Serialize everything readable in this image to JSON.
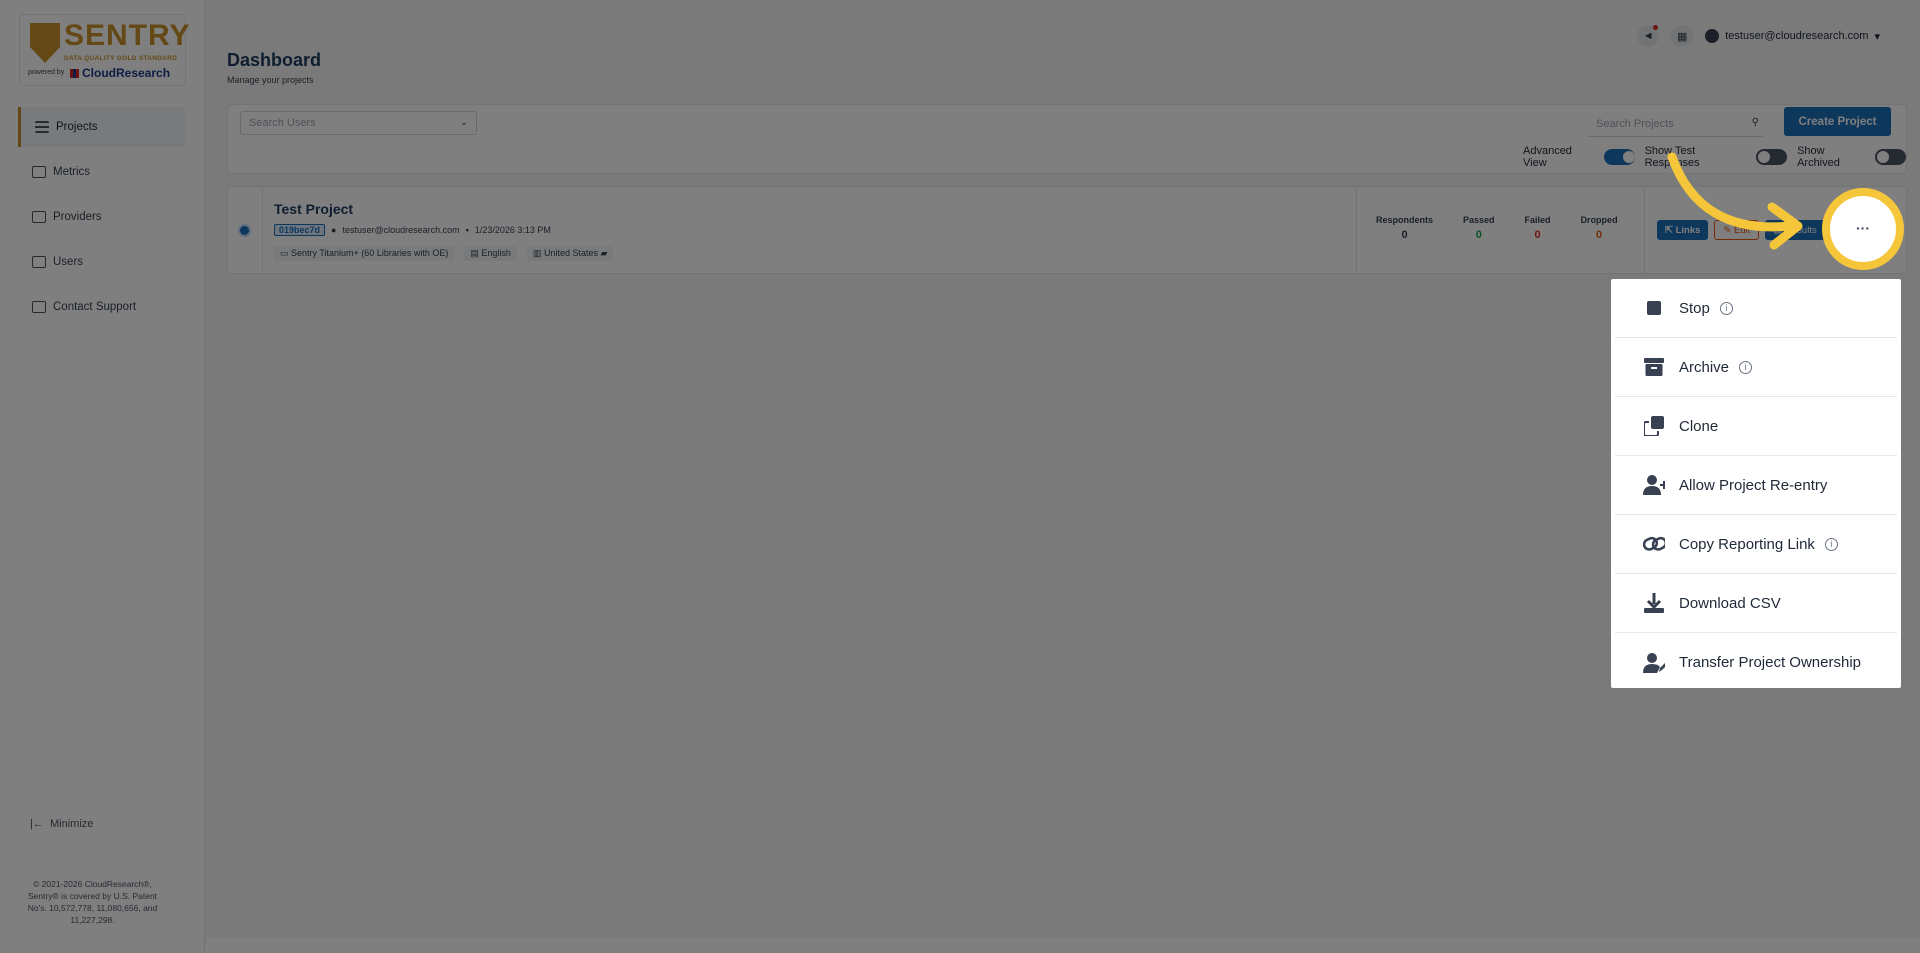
{
  "brand": {
    "name": "SENTRY",
    "tagline": "DATA QUALITY GOLD STANDARD",
    "powered_by": "powered by",
    "company": "CloudResearch"
  },
  "sidebar": {
    "items": [
      {
        "label": "Projects",
        "icon": "list-icon"
      },
      {
        "label": "Metrics",
        "icon": "chart-icon"
      },
      {
        "label": "Providers",
        "icon": "people-icon"
      },
      {
        "label": "Users",
        "icon": "user-icon"
      },
      {
        "label": "Contact Support",
        "icon": "mail-icon"
      }
    ],
    "minimize_label": "Minimize",
    "copyright": "© 2021-2026 CloudResearch®, Sentry® is covered by U.S. Patent No's. 10,572,778, 11,080,656, and 11,227,298."
  },
  "header": {
    "user_email": "testuser@cloudresearch.com"
  },
  "page": {
    "title": "Dashboard",
    "subtitle": "Manage your projects"
  },
  "filters": {
    "search_users_placeholder": "Search Users",
    "search_projects_placeholder": "Search Projects",
    "create_project_label": "Create Project",
    "advanced_view_label": "Advanced View",
    "advanced_view_on": true,
    "show_test_label": "Show Test Responses",
    "show_test_on": false,
    "show_archived_label": "Show Archived",
    "show_archived_on": false
  },
  "project": {
    "name": "Test Project",
    "id": "019bec7d",
    "owner": "testuser@cloudresearch.com",
    "date": "1/23/2026 3:13 PM",
    "library": "Sentry Titanium+ (60 Libraries with OE)",
    "language": "English",
    "country": "United States",
    "stats": [
      {
        "label": "Respondents",
        "value": "0",
        "color": "#374151"
      },
      {
        "label": "Passed",
        "value": "0",
        "color": "#16a34a"
      },
      {
        "label": "Failed",
        "value": "0",
        "color": "#dc2626"
      },
      {
        "label": "Dropped",
        "value": "0",
        "color": "#ea580c"
      }
    ],
    "links_label": "Links",
    "edit_label": "Edit",
    "results_label": "Results"
  },
  "menu": {
    "items": [
      {
        "label": "Stop",
        "icon": "stop-icon",
        "info": true
      },
      {
        "label": "Archive",
        "icon": "archive-icon",
        "info": true
      },
      {
        "label": "Clone",
        "icon": "clone-icon",
        "info": false
      },
      {
        "label": "Allow Project Re-entry",
        "icon": "user-plus-icon",
        "info": false
      },
      {
        "label": "Copy Reporting Link",
        "icon": "link-icon",
        "info": true
      },
      {
        "label": "Download CSV",
        "icon": "download-icon",
        "info": false
      },
      {
        "label": "Transfer Project Ownership",
        "icon": "user-edit-icon",
        "info": false
      }
    ]
  },
  "colors": {
    "brand_gold": "#c9932c",
    "primary_blue": "#1d6fb8",
    "annotation_yellow": "#f5c63a"
  }
}
